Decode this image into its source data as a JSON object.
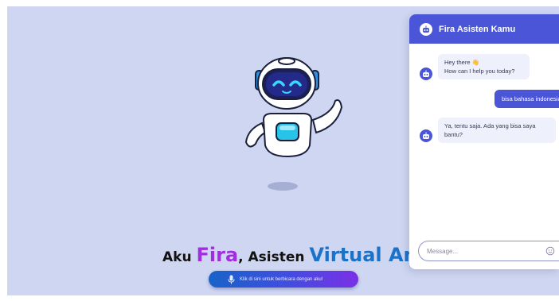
{
  "chat": {
    "title": "Fira Asisten Kamu",
    "messages": [
      {
        "from": "bot",
        "text": "Hey there 👋\nHow can I help you today?"
      },
      {
        "from": "user",
        "text": "bisa bahasa indonesia"
      },
      {
        "from": "bot",
        "text": "Ya, tentu saja. Ada yang bisa saya bantu?"
      }
    ],
    "input": {
      "placeholder": "Message...",
      "value": ""
    }
  },
  "hero": {
    "prefix": "Aku ",
    "name": "Fira",
    "middle": ", Asisten ",
    "highlight": "Virtual Anda",
    "suffix": "."
  },
  "speak_button": {
    "label": "Klik di sini untuk berbicara dengan aku!"
  },
  "colors": {
    "accent": "#4a55d8",
    "name": "#a12ee0",
    "highlight": "#1b72c9",
    "background": "#cfd6f1"
  },
  "icons": [
    "robot-mascot",
    "bot-icon",
    "microphone-icon",
    "emoji-icon"
  ]
}
